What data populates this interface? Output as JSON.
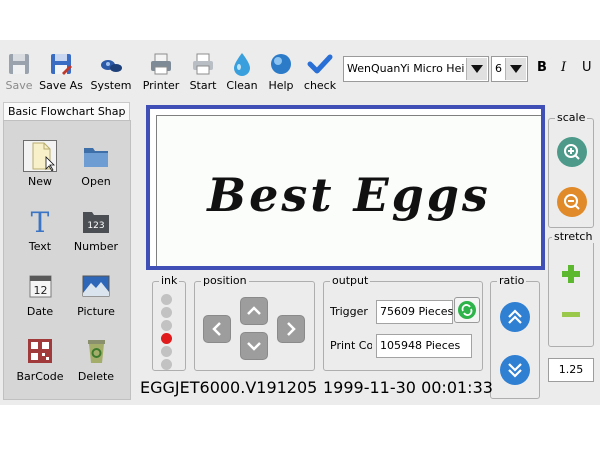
{
  "toolbar": {
    "save": "Save",
    "save_as": "Save As",
    "system": "System",
    "printer": "Printer",
    "start": "Start",
    "clean": "Clean",
    "help": "Help",
    "check": "check"
  },
  "font": {
    "family": "WenQuanYi Micro Hei",
    "size": "6"
  },
  "format": {
    "bold": "B",
    "italic": "I",
    "underline": "U"
  },
  "left_panel": {
    "tab": "Basic Flowchart Shap",
    "shapes": [
      "New",
      "Open",
      "Text",
      "Number",
      "Date",
      "Picture",
      "BarCode",
      "Delete"
    ],
    "number_icon_text": "123",
    "date_icon_text": "12"
  },
  "canvas": {
    "text": "Best Eggs"
  },
  "ink": {
    "title": "ink",
    "levels": 6,
    "active_index": 3
  },
  "position": {
    "title": "position"
  },
  "output": {
    "title": "output",
    "trigger_label": "Trigger C",
    "trigger_value": "75609  Pieces",
    "print_label": "Print Cou",
    "print_value": "105948  Pieces"
  },
  "ratio": {
    "title": "ratio"
  },
  "scale": {
    "title": "scale"
  },
  "stretch": {
    "title": "stretch",
    "value": "1.25"
  },
  "status": {
    "version": "EGGJET6000.V191205",
    "datetime": "1999-11-30 00:01:33"
  },
  "colors": {
    "canvas_border": "#3f4fb5",
    "ink_active": "#e11b1b",
    "accent_green": "#2db34a"
  }
}
